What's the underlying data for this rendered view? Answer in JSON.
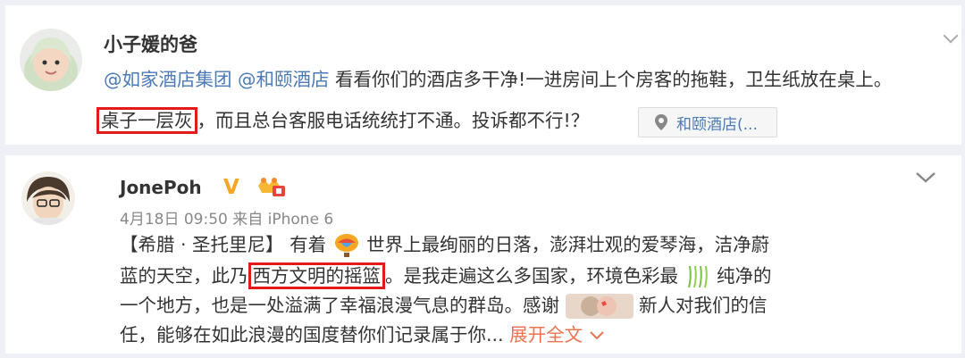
{
  "post1": {
    "username": "小子媛的爸",
    "line1": {
      "mention1": "@如家酒店集团",
      "mention2": "@和颐酒店",
      "text": " 看看你们的酒店多干净!一进房间上个房客的拖鞋，卫生纸放在桌上。"
    },
    "line2": {
      "highlight": "桌子一层灰",
      "text": "，而且总台客服电话统统打不通。投诉都不行!？"
    },
    "location_label": "和颐酒店(...",
    "icons": {
      "avatar": "child-avatar",
      "location": "location-pin-icon",
      "more": "chevron-down-icon"
    }
  },
  "post2": {
    "username": "JonePoh",
    "verified_badge": "V",
    "meta": "4月18日 09:50 来自 iPhone 6",
    "line1": {
      "a": "【希腊 · 圣托里尼】 有着 ",
      "b": " 世界上最绚丽的日落，澎湃壮观的爱琴海，洁净蔚"
    },
    "line2": {
      "a": "蓝的天空，此乃",
      "highlight": "西方文明的摇篮",
      "b": "。是我走遍这么多国家，环境色彩最 ",
      "c": " 纯净的"
    },
    "line3": {
      "a": "一个地方，也是一处溢满了幸福浪漫气息的群岛。感谢 ",
      "b": " 新人对我们的信"
    },
    "line4": {
      "a": "任，能够在如此浪漫的国度替你们记录属于你... ",
      "expand": "展开全文"
    },
    "icons": {
      "avatar": "user-avatar",
      "verified": "verified-v-icon",
      "member": "member-badge-icon",
      "balloon": "hot-air-balloon-icon",
      "willow": "willow-icon",
      "couple": "couple-photo-icon",
      "more": "chevron-down-icon"
    },
    "colors": {
      "link": "#eb7350",
      "mention": "#4a7ab7",
      "highlight_border": "#e21a1a"
    }
  }
}
